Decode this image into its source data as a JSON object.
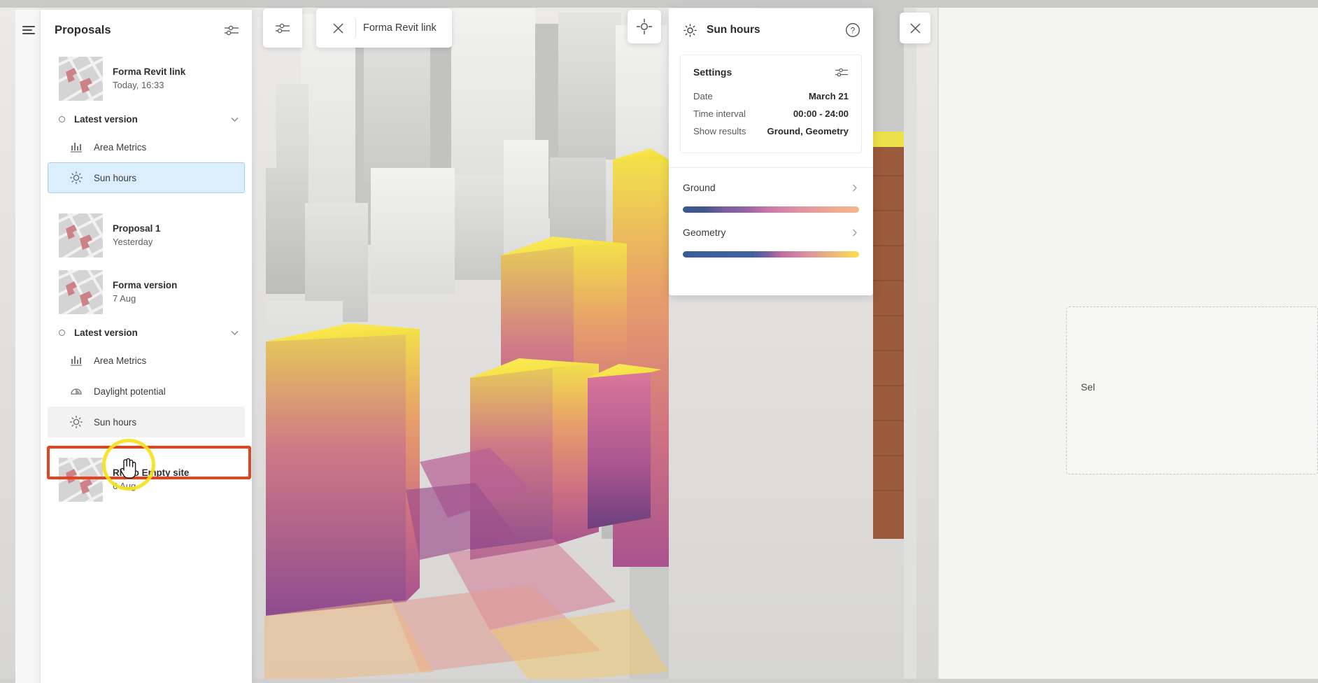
{
  "app": {
    "name": "Forma",
    "accent_blue": "#dceefb",
    "accent_blue_border": "#a9cfeb",
    "annotation_orange": "#e8421d",
    "annotation_yellow": "#f5e11c"
  },
  "toolbar": {
    "settings_icon": "sliders-icon",
    "close_icon": "close-icon",
    "project_label": "Forma Revit link",
    "crosshair_icon": "crosshair-target-icon",
    "far_close_icon": "close-icon"
  },
  "sidebar": {
    "menu_icon": "hamburger-menu-icon",
    "title": "Proposals",
    "filter_icon": "sliders-icon",
    "items": [
      {
        "type": "proposal",
        "name": "Forma Revit link",
        "date": "Today, 16:33",
        "thumbnail": "site-map-thumbnail"
      },
      {
        "type": "version",
        "label": "Latest version",
        "dot_icon": "circle-outline-icon",
        "chevron_icon": "chevron-down-icon"
      },
      {
        "type": "analysis",
        "label": "Area Metrics",
        "icon": "bar-chart-icon",
        "selected": false
      },
      {
        "type": "analysis",
        "label": "Sun hours",
        "icon": "sun-icon",
        "selected": true
      },
      {
        "type": "proposal",
        "name": "Proposal 1",
        "date": "Yesterday",
        "thumbnail": "site-map-thumbnail"
      },
      {
        "type": "proposal",
        "name": "Forma version",
        "date": "7 Aug",
        "thumbnail": "site-map-thumbnail"
      },
      {
        "type": "version",
        "label": "Latest version",
        "dot_icon": "circle-outline-icon",
        "chevron_icon": "chevron-down-icon"
      },
      {
        "type": "analysis",
        "label": "Area Metrics",
        "icon": "bar-chart-icon",
        "selected": false
      },
      {
        "type": "analysis",
        "label": "Daylight potential",
        "icon": "daylight-dome-icon",
        "selected": false
      },
      {
        "type": "analysis",
        "label": "Sun hours",
        "icon": "sun-icon",
        "selected": false,
        "highlighted": true
      },
      {
        "type": "proposal",
        "name": "Rhino Empty site",
        "date": "6 Aug",
        "thumbnail": "site-map-thumbnail"
      }
    ]
  },
  "sun_panel": {
    "icon": "sun-icon",
    "title": "Sun hours",
    "help_icon": "question-circle-icon",
    "settings": {
      "title": "Settings",
      "settings_icon": "sliders-icon",
      "rows": [
        {
          "key": "Date",
          "value": "March 21"
        },
        {
          "key": "Time interval",
          "value": "00:00 - 24:00"
        },
        {
          "key": "Show results",
          "value": "Ground, Geometry"
        }
      ]
    },
    "legends": [
      {
        "name": "Ground",
        "chevron_icon": "chevron-right-icon",
        "gradient_stops": [
          "#3c5a8c",
          "#42558a",
          "#7a5f9e",
          "#8e62a1",
          "#c878a8",
          "#d989a8",
          "#e49a9c",
          "#eeab94",
          "#f2b68c"
        ]
      },
      {
        "name": "Geometry",
        "chevron_icon": "chevron-right-icon",
        "gradient_stops": [
          "#3a5c96",
          "#3f5f9a",
          "#41619c",
          "#7a5f9e",
          "#c06f9f",
          "#d287a4",
          "#e0a08f",
          "#eeb97a",
          "#f6cf5f",
          "#fbe04c"
        ]
      }
    ]
  },
  "right_overlay": {
    "selection_text": "Sel"
  },
  "annotations": {
    "highlight_box_target": "Sun hours",
    "click_circle_target": "Sun hours",
    "cursor_icon": "pointer-hand-cursor"
  }
}
